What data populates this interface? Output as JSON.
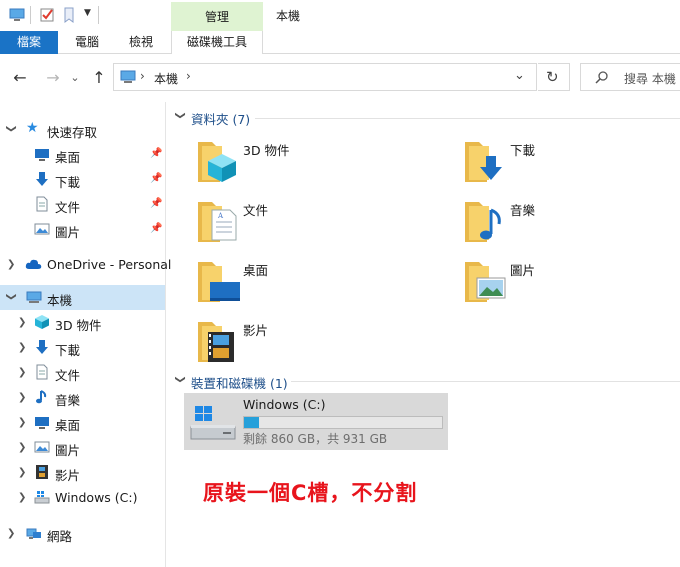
{
  "window": {
    "title": "本機"
  },
  "ribbon": {
    "context_group": "管理",
    "tabs": [
      {
        "label": "檔案"
      },
      {
        "label": "電腦"
      },
      {
        "label": "檢視"
      },
      {
        "label": "磁碟機工具"
      }
    ]
  },
  "address": {
    "crumb_sep": "›",
    "location": "本機",
    "search_placeholder": "搜尋 本機"
  },
  "nav": {
    "quick_access": "快速存取",
    "quick_items": [
      {
        "label": "桌面",
        "icon": "desktop-icon"
      },
      {
        "label": "下載",
        "icon": "download-icon"
      },
      {
        "label": "文件",
        "icon": "document-icon"
      },
      {
        "label": "圖片",
        "icon": "picture-icon"
      }
    ],
    "onedrive": "OneDrive - Personal",
    "this_pc": "本機",
    "pc_items": [
      {
        "label": "3D 物件",
        "icon": "3d-objects-icon"
      },
      {
        "label": "下載",
        "icon": "download-icon"
      },
      {
        "label": "文件",
        "icon": "document-icon"
      },
      {
        "label": "音樂",
        "icon": "music-icon"
      },
      {
        "label": "桌面",
        "icon": "desktop-icon"
      },
      {
        "label": "圖片",
        "icon": "picture-icon"
      },
      {
        "label": "影片",
        "icon": "video-icon"
      },
      {
        "label": "Windows (C:)",
        "icon": "drive-icon"
      }
    ],
    "network": "網路"
  },
  "main": {
    "folders_header": "資料夾 (7)",
    "folders": [
      {
        "label": "3D 物件",
        "icon": "3d-objects-icon"
      },
      {
        "label": "下載",
        "icon": "download-icon"
      },
      {
        "label": "文件",
        "icon": "document-icon"
      },
      {
        "label": "音樂",
        "icon": "music-icon"
      },
      {
        "label": "桌面",
        "icon": "desktop-icon"
      },
      {
        "label": "圖片",
        "icon": "picture-icon"
      },
      {
        "label": "影片",
        "icon": "video-icon"
      }
    ],
    "devices_header": "裝置和磁碟機 (1)",
    "drive": {
      "name": "Windows (C:)",
      "free_text": "剩餘 860 GB，共 931 GB",
      "used_fraction": 0.076
    }
  },
  "annotation": "原裝一個C槽，不分割",
  "colors": {
    "accent": "#1a73c6",
    "context_tab": "#dff3d2",
    "selection": "#cce4f7",
    "bar_fill": "#26a0da",
    "annotation": "#e8141c"
  }
}
